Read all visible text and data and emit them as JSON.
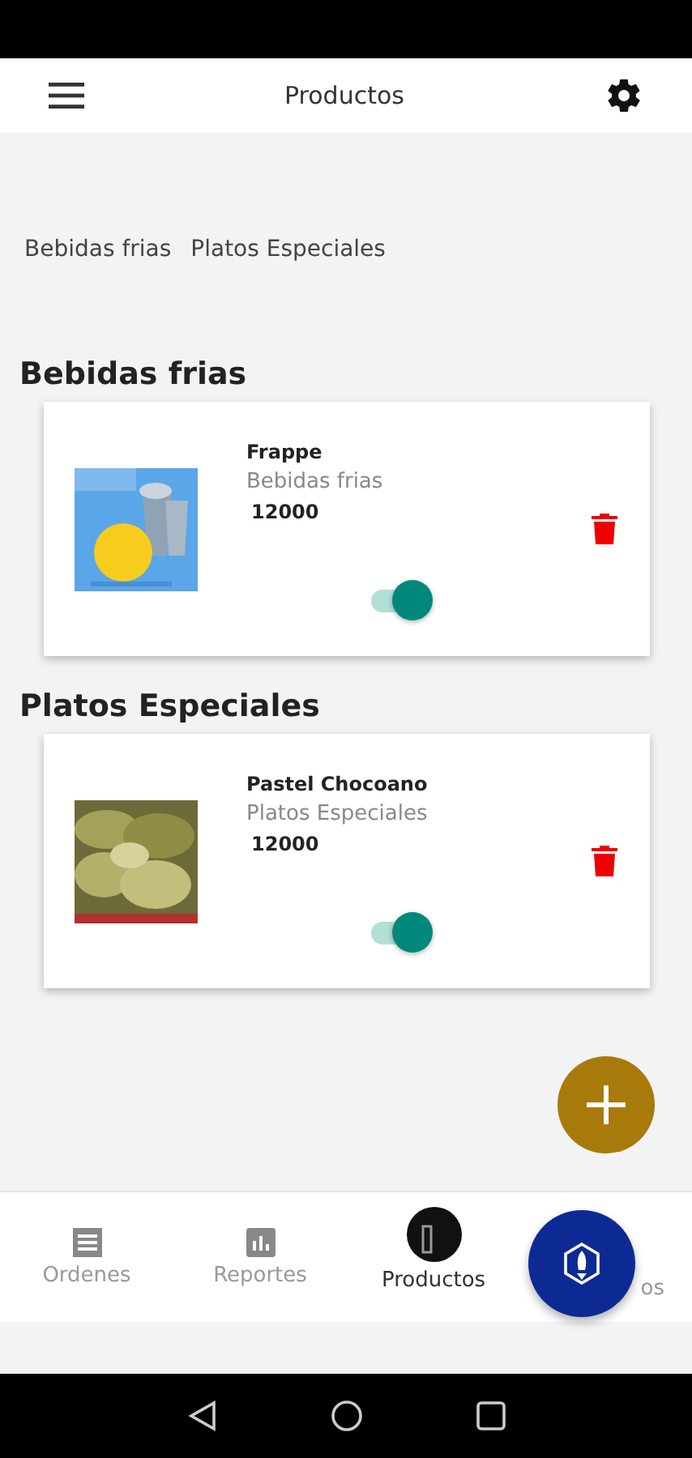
{
  "header": {
    "title": "Productos"
  },
  "filters": [
    "Bebidas frias",
    "Platos Especiales"
  ],
  "sections": [
    {
      "title": "Bebidas frias",
      "products": [
        {
          "name": "Frappe",
          "category": "Bebidas frias",
          "price": "12000",
          "on": true,
          "kind": "drink"
        }
      ]
    },
    {
      "title": "Platos Especiales",
      "products": [
        {
          "name": "Pastel Chocoano",
          "category": "Platos Especiales",
          "price": "12000",
          "on": true,
          "kind": "food"
        }
      ]
    }
  ],
  "nav": [
    {
      "label": "Ordenes",
      "kind": "list",
      "selected": false
    },
    {
      "label": "Reportes",
      "kind": "chart",
      "selected": false
    },
    {
      "label": "Productos",
      "kind": "box",
      "selected": true
    },
    {
      "label": "os",
      "kind": "plain",
      "selected": false
    }
  ]
}
